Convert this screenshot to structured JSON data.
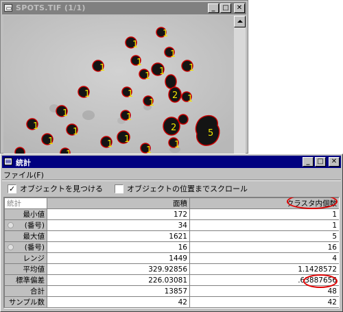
{
  "image_window": {
    "title": "SPOTS.TIF (1/1)",
    "buttons": {
      "minimize": "_",
      "maximize": "□",
      "close": "✕"
    },
    "spot_labels": [
      "1",
      "1",
      "1",
      "1",
      "1",
      "1",
      "1",
      "1",
      "1",
      "2",
      "1",
      "1",
      "1",
      "1",
      "1",
      "1",
      "1",
      "2",
      "5",
      "1",
      "1",
      "1",
      "1",
      "1",
      "1"
    ]
  },
  "stats_window": {
    "title": "統計",
    "buttons": {
      "minimize": "_",
      "maximize": "□",
      "close": "✕"
    },
    "menu": {
      "file": "ファイル(F)"
    },
    "options": {
      "find_objects": {
        "label": "オブジェクトを見つける",
        "checked": true
      },
      "scroll_to_object": {
        "label": "オブジェクトの位置までスクロール",
        "checked": false
      }
    },
    "table": {
      "corner": "統計",
      "columns": [
        "面積",
        "クラスタ内個数"
      ],
      "rows": [
        {
          "label": "最小値",
          "area": "172",
          "count": "1"
        },
        {
          "label": "(番号)",
          "area": "34",
          "count": "1"
        },
        {
          "label": "最大値",
          "area": "1621",
          "count": "5"
        },
        {
          "label": "(番号)",
          "area": "16",
          "count": "16"
        },
        {
          "label": "レンジ",
          "area": "1449",
          "count": "4"
        },
        {
          "label": "平均値",
          "area": "329.92856",
          "count": "1.1428572"
        },
        {
          "label": "標準偏差",
          "area": "226.03081",
          "count": ".63887656"
        },
        {
          "label": "合計",
          "area": "13857",
          "count": "48"
        },
        {
          "label": "サンプル数",
          "area": "42",
          "count": "42"
        }
      ]
    },
    "highlight_color": "#e00000"
  }
}
